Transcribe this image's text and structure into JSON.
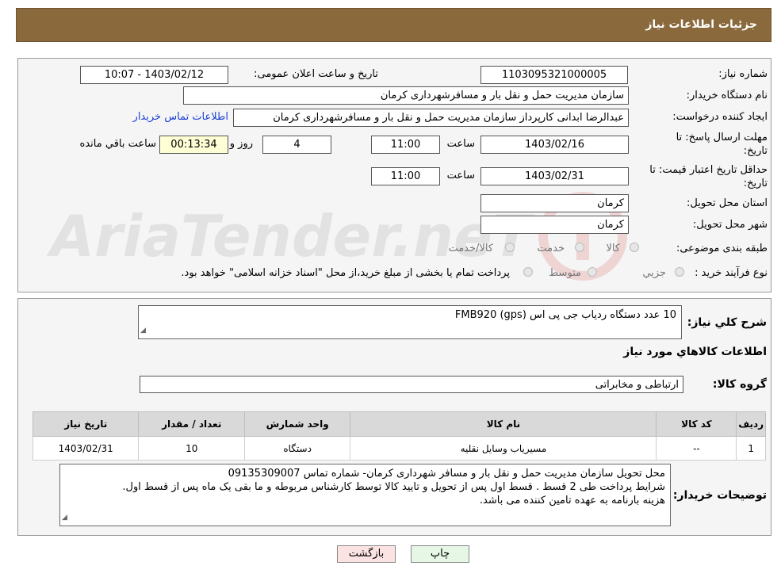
{
  "header": {
    "title": "جزئیات اطلاعات نیاز"
  },
  "form": {
    "need_number_label": "شماره نیاز:",
    "need_number": "1103095321000005",
    "announce_label": "تاریخ و ساعت اعلان عمومی:",
    "announce_value": "1403/02/12 - 10:07",
    "buyer_org_label": "نام دستگاه خریدار:",
    "buyer_org": "سازمان مدیریت حمل و نقل بار و مسافرشهرداری کرمان",
    "creator_label": "ایجاد کننده درخواست:",
    "creator": "عبدالرضا ابدانی کارپرداز سازمان مدیریت حمل و نقل بار و مسافرشهرداری کرمان",
    "contact_link": "اطلاعات تماس خریدار",
    "deadline_label_1": "مهلت ارسال پاسخ: تا",
    "deadline_label_2": "تاریخ:",
    "deadline_date": "1403/02/16",
    "time_label": "ساعت",
    "deadline_time": "11:00",
    "days_value": "4",
    "days_label": "روز و",
    "remaining_time": "00:13:34",
    "remaining_label": "ساعت باقي مانده",
    "validity_label_1": "حداقل تاریخ اعتبار قیمت: تا",
    "validity_label_2": "تاریخ:",
    "validity_date": "1403/02/31",
    "validity_time": "11:00",
    "province_label": "استان محل تحویل:",
    "province": "کرمان",
    "city_label": "شهر محل تحویل:",
    "city": "کرمان",
    "category_label": "طبقه بندی موضوعی:",
    "category_options": [
      "کالا",
      "خدمت",
      "کالا/خدمت"
    ],
    "process_label": "نوع فرآیند خرید :",
    "process_options": [
      "جزيي",
      "متوسط"
    ],
    "process_note": "پرداخت تمام یا بخشی از مبلغ خرید،از محل \"اسناد خزانه اسلامی\" خواهد بود."
  },
  "description": {
    "label": "شرح کلي نياز:",
    "value": "10 عدد دستگاه ردیاب جی پی اس (FMB920 (gps"
  },
  "goods_section_title": "اطلاعات کالاهاي مورد نياز",
  "goods_group": {
    "label": "گروه کالا:",
    "value": "ارتباطی و مخابراتی"
  },
  "table": {
    "headers": [
      "رديف",
      "کد کالا",
      "نام کالا",
      "واحد شمارش",
      "تعداد / مقدار",
      "تاریخ نیاز"
    ],
    "rows": [
      {
        "row": "1",
        "code": "--",
        "name": "مسیریاب وسایل نقلیه",
        "unit": "دستگاه",
        "qty": "10",
        "date": "1403/02/31"
      }
    ]
  },
  "buyer_notes": {
    "label": "توضیحات خریدار:",
    "lines": [
      "محل تحویل سازمان مدیریت حمل و نقل بار و مسافر شهرداری کرمان- شماره تماس 09135309007",
      "شرایط پرداخت طی 2 قسط . قسط اول پس از تحویل و تایید کالا توسط کارشناس مربوطه و ما بقی یک ماه پس از قسط اول.",
      "هزینه بارنامه به عهده تامین کننده می باشد."
    ]
  },
  "buttons": {
    "print": "چاپ",
    "back": "بازگشت"
  },
  "watermark": {
    "text": "AriaTender.neT"
  },
  "colors": {
    "header_bg": "#8a6a3c",
    "print_bg": "#e6f7e6",
    "back_bg": "#fbe3e3",
    "link": "#1a3fd6"
  },
  "icons": {
    "resize": "resize-grip-icon",
    "logo": "ariatender-logo-icon"
  }
}
